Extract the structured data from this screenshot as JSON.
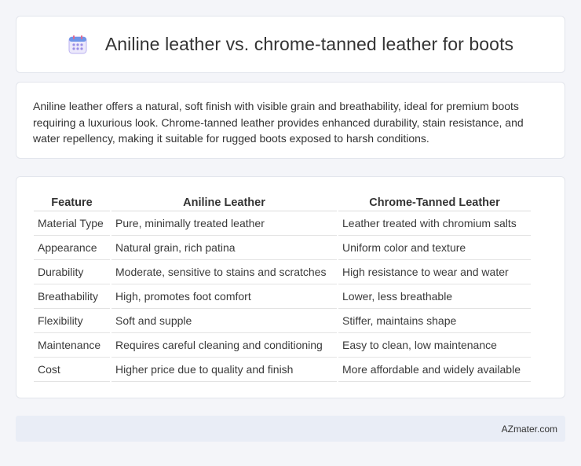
{
  "header": {
    "title": "Aniline leather vs. chrome-tanned leather for boots",
    "icon": "calendar-icon"
  },
  "summary": {
    "text": "Aniline leather offers a natural, soft finish with visible grain and breathability, ideal for premium boots requiring a luxurious look. Chrome-tanned leather provides enhanced durability, stain resistance, and water repellency, making it suitable for rugged boots exposed to harsh conditions."
  },
  "table": {
    "headers": [
      "Feature",
      "Aniline Leather",
      "Chrome-Tanned Leather"
    ],
    "rows": [
      [
        "Material Type",
        "Pure, minimally treated leather",
        "Leather treated with chromium salts"
      ],
      [
        "Appearance",
        "Natural grain, rich patina",
        "Uniform color and texture"
      ],
      [
        "Durability",
        "Moderate, sensitive to stains and scratches",
        "High resistance to wear and water"
      ],
      [
        "Breathability",
        "High, promotes foot comfort",
        "Lower, less breathable"
      ],
      [
        "Flexibility",
        "Soft and supple",
        "Stiffer, maintains shape"
      ],
      [
        "Maintenance",
        "Requires careful cleaning and conditioning",
        "Easy to clean, low maintenance"
      ],
      [
        "Cost",
        "Higher price due to quality and finish",
        "More affordable and widely available"
      ]
    ]
  },
  "footer": {
    "text": "AZmater.com"
  },
  "colors": {
    "background": "#f4f5f9",
    "card": "#ffffff",
    "footer": "#e9edf6",
    "icon_accent": "#8b7fe0"
  }
}
